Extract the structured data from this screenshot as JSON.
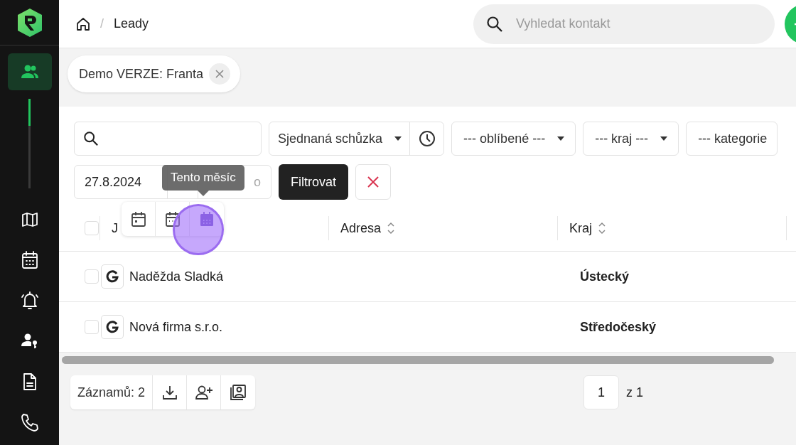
{
  "sidebar": {
    "items": [
      {
        "selected": true
      },
      {
        "selected": false
      },
      {
        "selected": false
      },
      {
        "selected": false
      },
      {
        "selected": false
      },
      {
        "selected": false
      },
      {
        "selected": false
      }
    ]
  },
  "breadcrumb": {
    "separator": "/",
    "current": "Leady"
  },
  "search": {
    "placeholder": "Vyhledat kontakt"
  },
  "filter_chip": {
    "label": "Demo VERZE: Franta"
  },
  "filters": {
    "status": "Sjednaná schůzka",
    "dropdowns": [
      "--- oblíbené ---",
      "--- kraj ---",
      "--- kategorie"
    ],
    "date_from": "27.8.2024",
    "date_to_visible": "o",
    "apply": "Filtrovat"
  },
  "tooltip": "Tento měsíc",
  "date_presets": [
    {
      "selected": false
    },
    {
      "selected": false
    },
    {
      "selected": true
    }
  ],
  "table": {
    "all_checked": false,
    "columns": [
      "J",
      "Adresa",
      "Kraj"
    ],
    "rows": [
      {
        "checked": false,
        "name": "Naděžda Sladká",
        "region": "Ústecký"
      },
      {
        "checked": false,
        "name": "Nová firma s.r.o.",
        "region": "Středočeský"
      }
    ]
  },
  "footer": {
    "count": "Záznamů: 2",
    "page": "1",
    "of": "z 1"
  }
}
